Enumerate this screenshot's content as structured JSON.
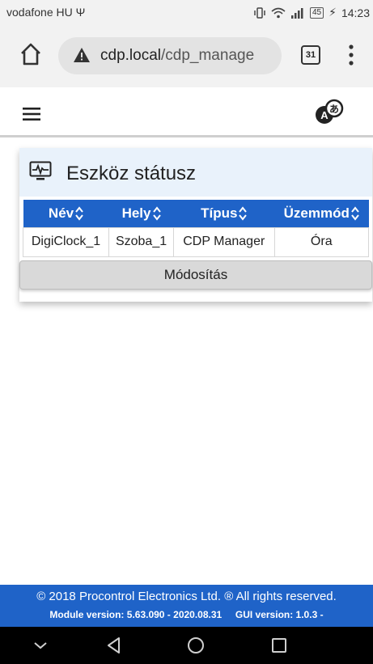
{
  "statusbar": {
    "carrier": "vodafone HU",
    "battery": "45",
    "time": "14:23"
  },
  "browser": {
    "url_host": "cdp.local",
    "url_path": "/cdp_manage",
    "tab_count": "31"
  },
  "card": {
    "title": "Eszköz státusz",
    "columns": [
      "Név",
      "Hely",
      "Típus",
      "Üzemmód"
    ],
    "rows": [
      [
        "DigiClock_1",
        "Szoba_1",
        "CDP Manager",
        "Óra"
      ]
    ],
    "modify_label": "Módosítás"
  },
  "footer": {
    "copyright": "© 2018 Procontrol Electronics Ltd. ® All rights reserved.",
    "version": "Module version: 5.63.090 - 2020.08.31     GUI version: 1.0.3 -"
  },
  "colors": {
    "accent": "#1f63c8",
    "card_header": "#e9f2fb"
  }
}
